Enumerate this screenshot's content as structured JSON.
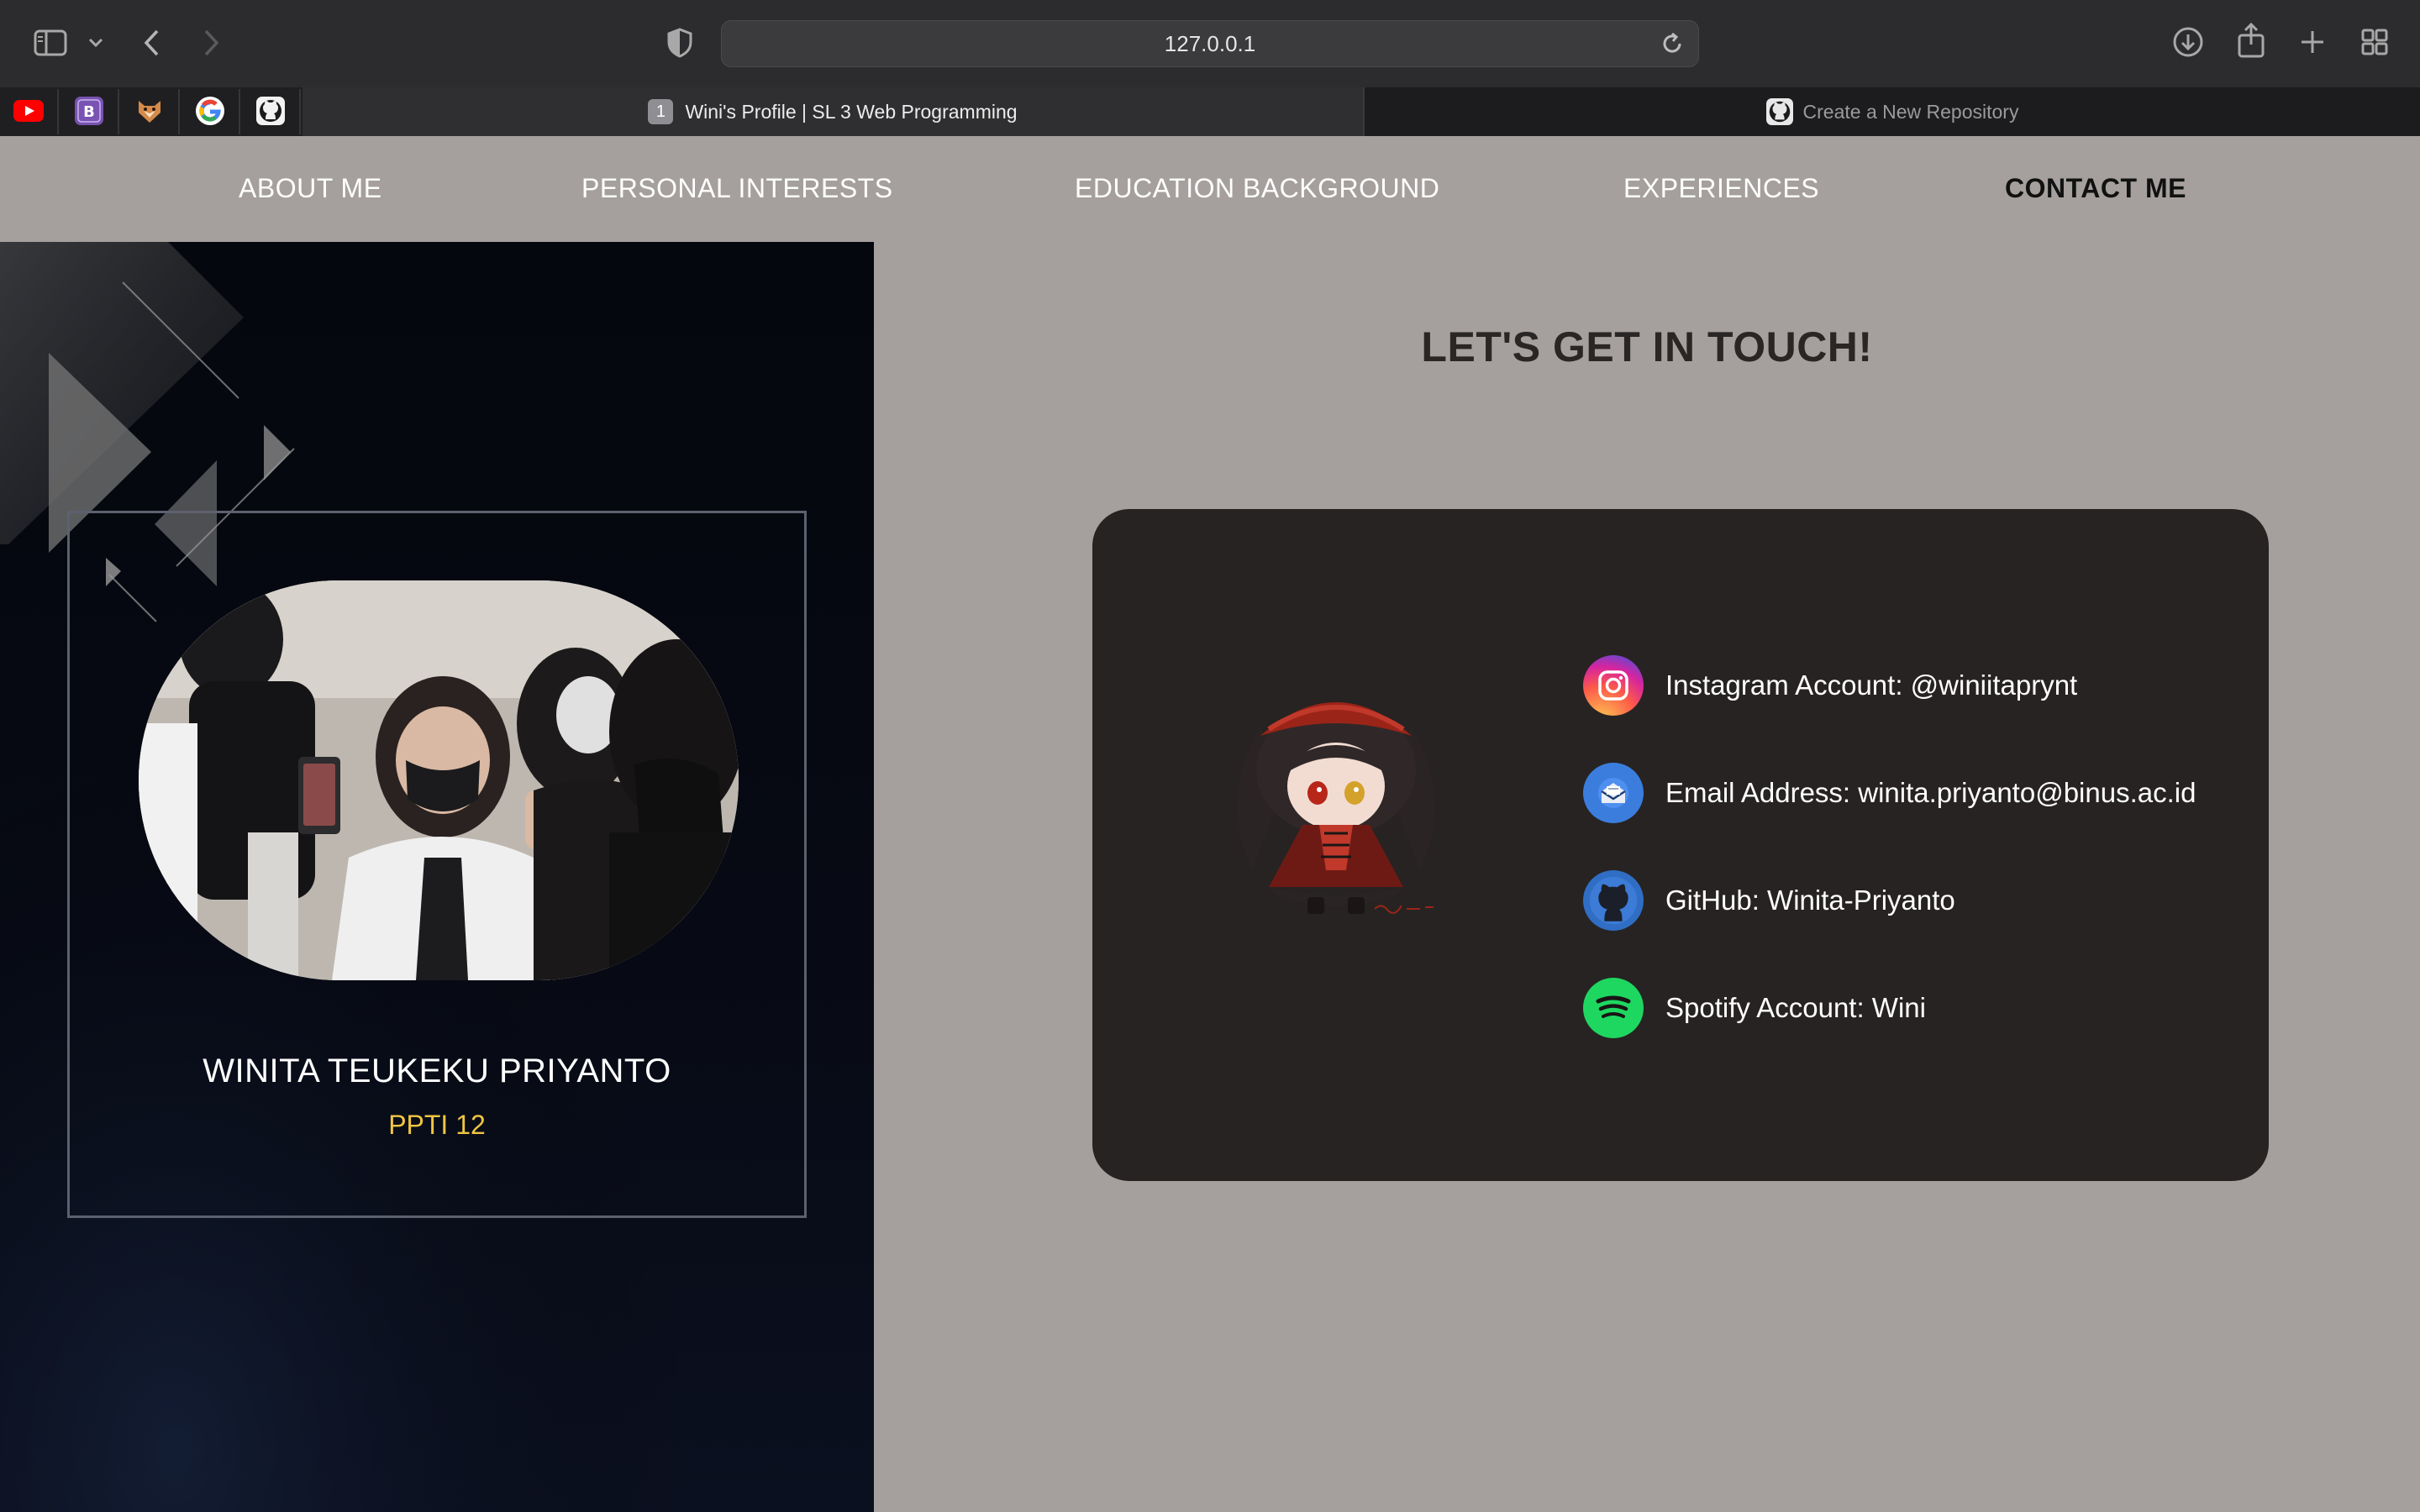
{
  "browser": {
    "url": "127.0.0.1",
    "toolbar_icons": [
      "sidebar-icon",
      "chevron-down-icon",
      "back-icon",
      "forward-icon",
      "shield-icon",
      "reload-icon",
      "download-icon",
      "share-icon",
      "new-tab-icon",
      "tab-overview-icon"
    ],
    "favorites": [
      "youtube-icon",
      "bootstrap-icon",
      "fox-icon",
      "google-icon",
      "github-icon"
    ],
    "tabs": [
      {
        "number": "1",
        "title": "Wini's Profile | SL 3 Web Programming",
        "active": true
      },
      {
        "title": "Create a New Repository",
        "active": false,
        "icon": "github-icon"
      }
    ]
  },
  "nav": {
    "items": [
      {
        "label": "ABOUT ME"
      },
      {
        "label": "PERSONAL INTERESTS"
      },
      {
        "label": "EDUCATION BACKGROUND"
      },
      {
        "label": "EXPERIENCES"
      },
      {
        "label": "CONTACT ME",
        "active": true
      }
    ]
  },
  "profile": {
    "name": "WINITA TEUKEKU PRIYANTO",
    "class": "PPTI 12"
  },
  "contact": {
    "title": "LET'S GET IN TOUCH!",
    "items": [
      {
        "icon": "instagram-icon",
        "text": "Instagram Account: @winiitaprynt"
      },
      {
        "icon": "email-icon",
        "text": "Email Address: winita.priyanto@binus.ac.id"
      },
      {
        "icon": "github-icon",
        "text": "GitHub: Winita-Priyanto"
      },
      {
        "icon": "spotify-icon",
        "text": "Spotify Account: Wini"
      }
    ]
  },
  "colors": {
    "page_bg": "#a5a09d",
    "card_bg": "#272322",
    "accent_gold": "#f0c542",
    "spotify_green": "#1ed760"
  }
}
